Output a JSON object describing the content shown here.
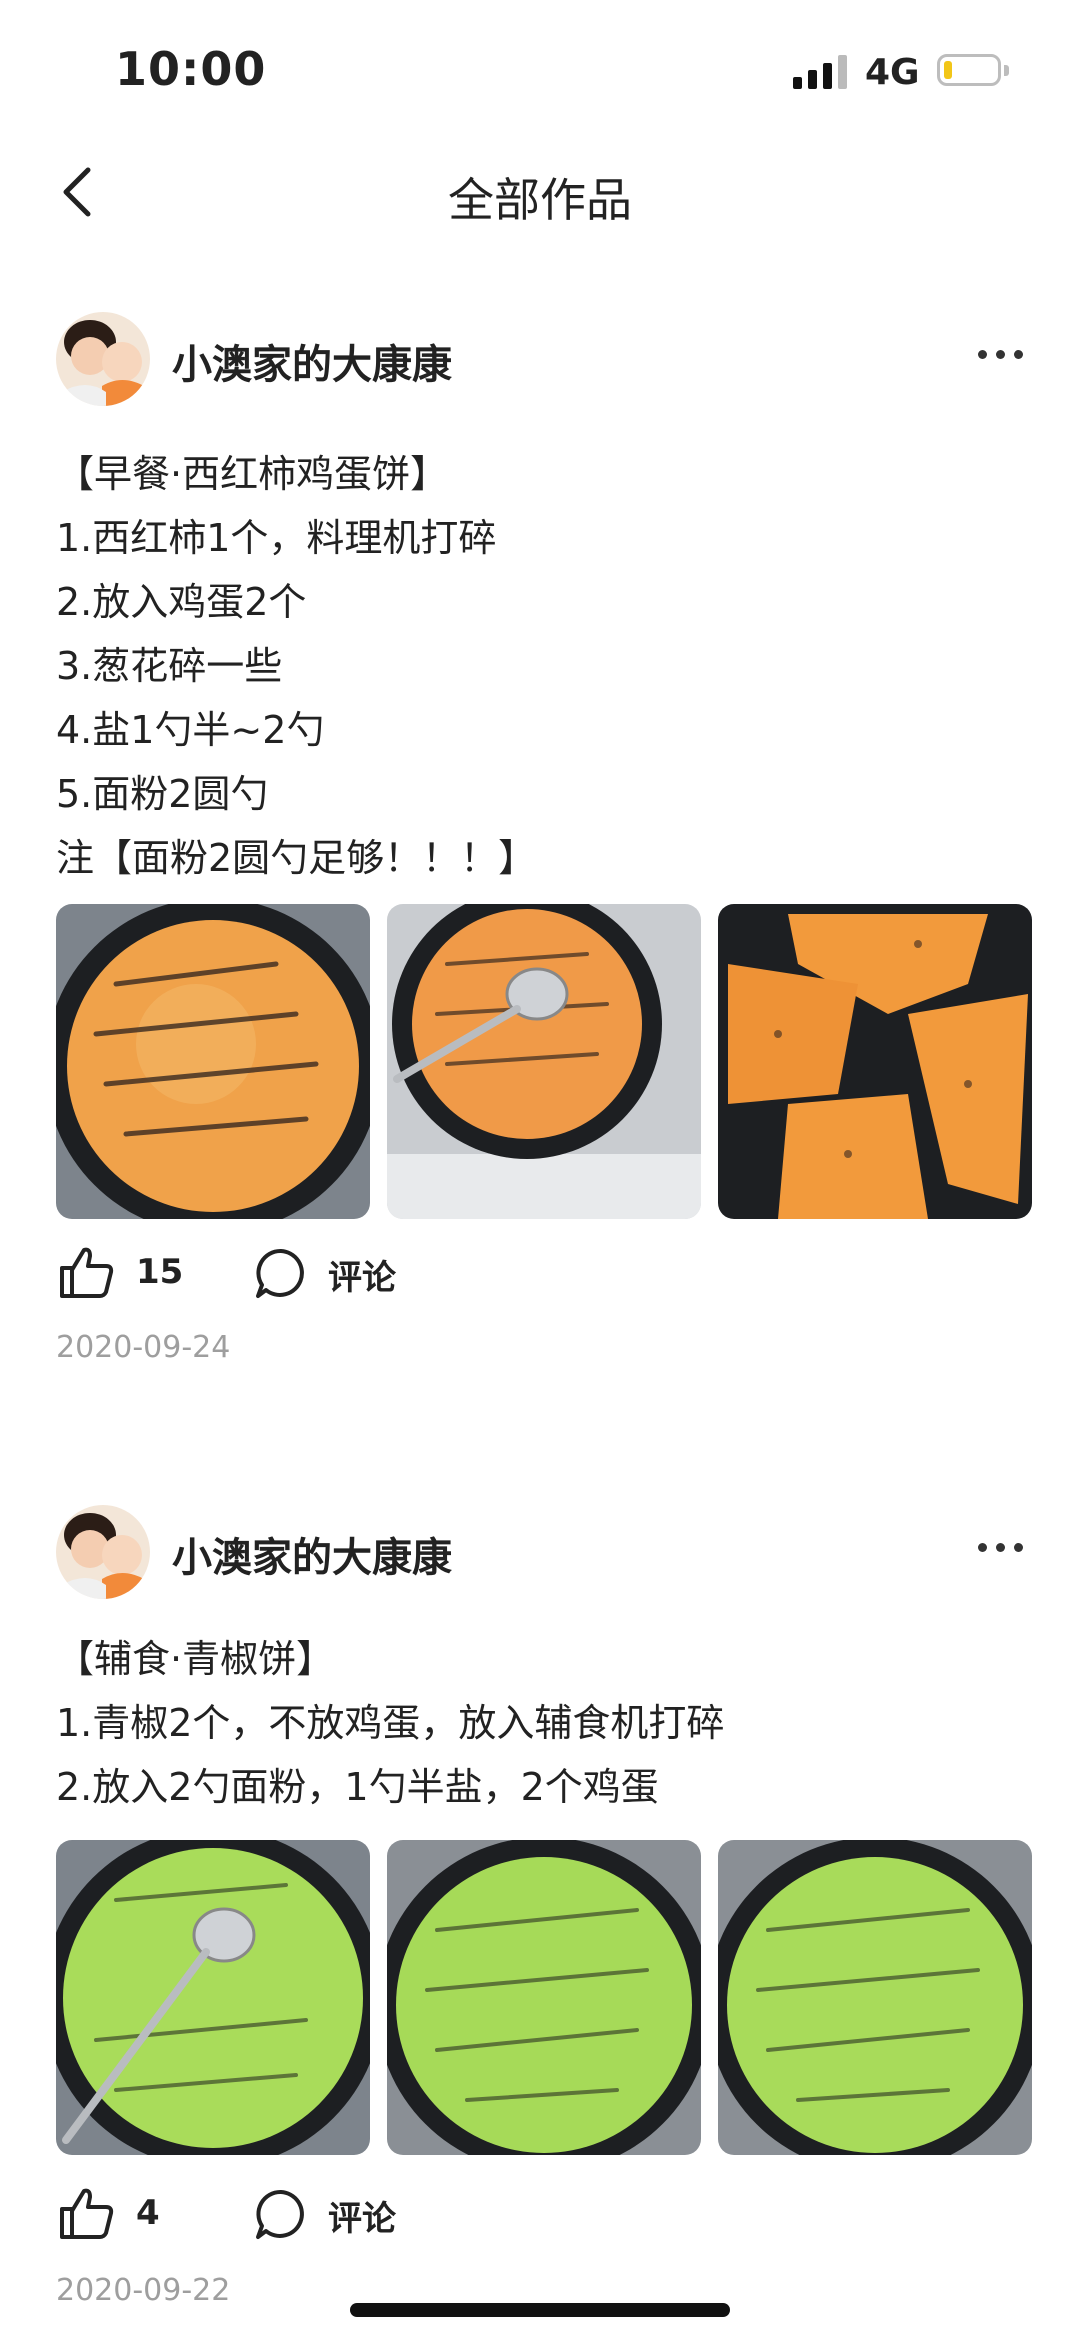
{
  "status_bar": {
    "time": "10:00",
    "network": "4G",
    "battery_level": 0.15
  },
  "nav": {
    "title": "全部作品",
    "back_icon": "chevron-left-icon"
  },
  "posts": [
    {
      "author": "小澳家的大康康",
      "lines": [
        "【早餐·西红柿鸡蛋饼】",
        "1.西红柿1个，料理机打碎",
        "2.放入鸡蛋2个",
        "3.葱花碎一些",
        "4.盐1勺半~2勺",
        "5.面粉2圆勺",
        "注【面粉2圆勺足够！！！】"
      ],
      "photos": [
        "tomato-egg-pancake",
        "tomato-egg-pancake-with-spoon",
        "tomato-egg-pancake-cut"
      ],
      "likes": "15",
      "comment_label": "评论",
      "date": "2020-09-24"
    },
    {
      "author": "小澳家的大康康",
      "lines": [
        "【辅食·青椒饼】",
        "1.青椒2个，不放鸡蛋，放入辅食机打碎",
        "2.放入2勺面粉，1勺半盐，2个鸡蛋"
      ],
      "photos": [
        "green-pepper-pancake-with-spoon",
        "green-pepper-pancake",
        "green-pepper-pancake"
      ],
      "likes": "4",
      "comment_label": "评论",
      "date": "2020-09-22"
    }
  ],
  "colors": {
    "text": "#222222",
    "date": "#9e9e9e",
    "battery": "#f2c618",
    "tomato": "#f0a24a",
    "pepper": "#a9dc5a"
  }
}
